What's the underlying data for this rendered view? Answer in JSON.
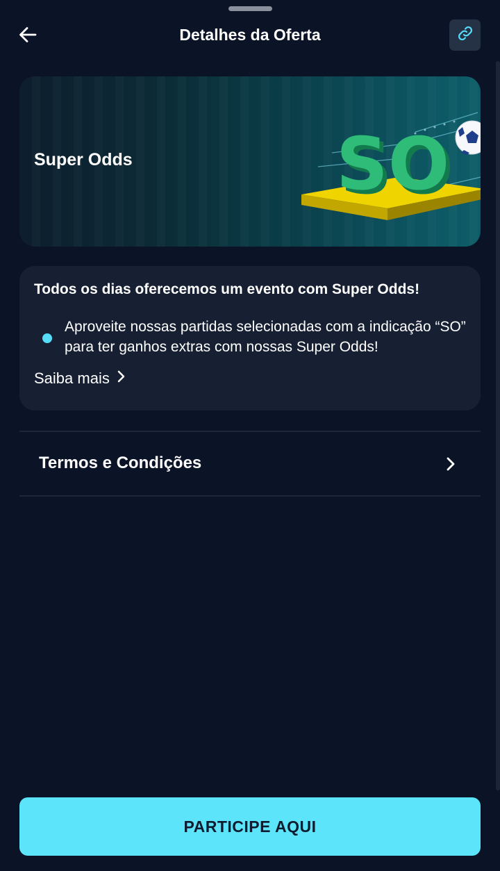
{
  "header": {
    "title": "Detalhes da Oferta",
    "back_icon": "arrow-left-icon",
    "link_icon": "link-icon"
  },
  "banner": {
    "title": "Super Odds",
    "art_text": "SO"
  },
  "info_card": {
    "heading": "Todos os dias oferecemos um evento com Super Odds!",
    "bullets": [
      "Aproveite nossas partidas selecionadas com a indicação “SO” para ter ganhos extras com nossas Super Odds!"
    ],
    "learn_more_label": "Saiba mais",
    "learn_more_icon": "chevron-right-icon"
  },
  "terms": {
    "label": "Termos e Condições",
    "icon": "chevron-right-icon"
  },
  "cta": {
    "label": "PARTICIPE AQUI"
  },
  "colors": {
    "background": "#0b1326",
    "card": "#172033",
    "accent": "#5ce5fa",
    "bullet": "#56dcf8"
  }
}
